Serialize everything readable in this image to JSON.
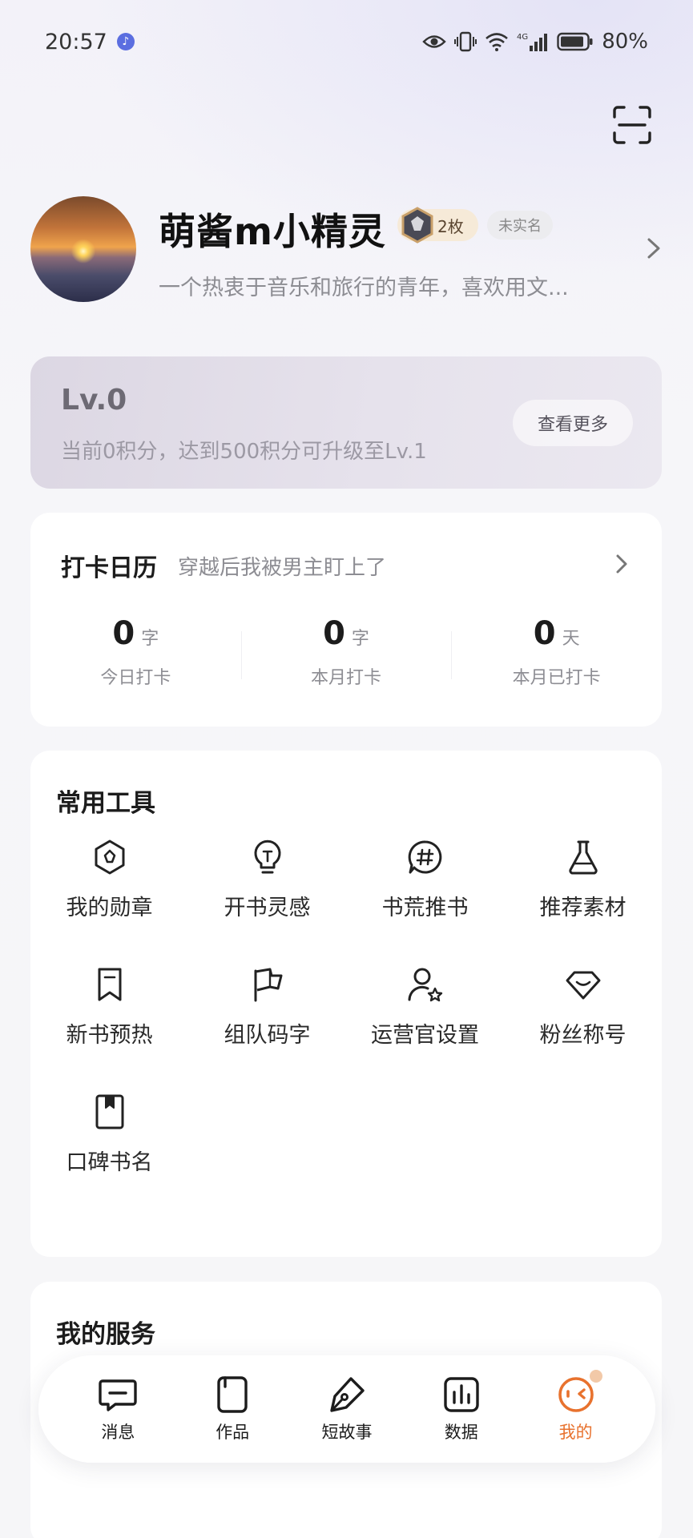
{
  "status_bar": {
    "time": "20:57",
    "battery": "80%",
    "network": "4G",
    "icons": [
      "music-icon",
      "eye-icon",
      "vibrate-icon",
      "wifi-icon",
      "signal-icon",
      "battery-icon"
    ]
  },
  "header": {
    "scan_icon": "scan-icon"
  },
  "profile": {
    "username": "萌酱m小精灵",
    "medal_count": "2枚",
    "realname_status": "未实名",
    "bio": "一个热衷于音乐和旅行的青年，喜欢用文..."
  },
  "level": {
    "title": "Lv.0",
    "description": "当前0积分，达到500积分可升级至Lv.1",
    "more_label": "查看更多"
  },
  "checkin": {
    "title": "打卡日历",
    "subtitle": "穿越后我被男主盯上了",
    "stats": [
      {
        "value": "0",
        "unit": "字",
        "label": "今日打卡"
      },
      {
        "value": "0",
        "unit": "字",
        "label": "本月打卡"
      },
      {
        "value": "0",
        "unit": "天",
        "label": "本月已打卡"
      }
    ]
  },
  "tools": {
    "title": "常用工具",
    "items": [
      {
        "label": "我的勋章",
        "icon": "medal-icon"
      },
      {
        "label": "开书灵感",
        "icon": "lightbulb-icon"
      },
      {
        "label": "书荒推书",
        "icon": "hashtag-chat-icon"
      },
      {
        "label": "推荐素材",
        "icon": "flask-icon"
      },
      {
        "label": "新书预热",
        "icon": "bookmark-icon"
      },
      {
        "label": "组队码字",
        "icon": "flag-icon"
      },
      {
        "label": "运营官设置",
        "icon": "user-star-icon"
      },
      {
        "label": "粉丝称号",
        "icon": "fan-badge-icon"
      },
      {
        "label": "口碑书名",
        "icon": "book-icon"
      }
    ]
  },
  "services": {
    "title": "我的服务"
  },
  "bottom_nav": {
    "items": [
      {
        "label": "消息",
        "icon": "message-icon",
        "active": false
      },
      {
        "label": "作品",
        "icon": "works-icon",
        "active": false
      },
      {
        "label": "短故事",
        "icon": "pen-icon",
        "active": false
      },
      {
        "label": "数据",
        "icon": "chart-icon",
        "active": false
      },
      {
        "label": "我的",
        "icon": "profile-face-icon",
        "active": true
      }
    ],
    "active_color": "#e8722e"
  }
}
